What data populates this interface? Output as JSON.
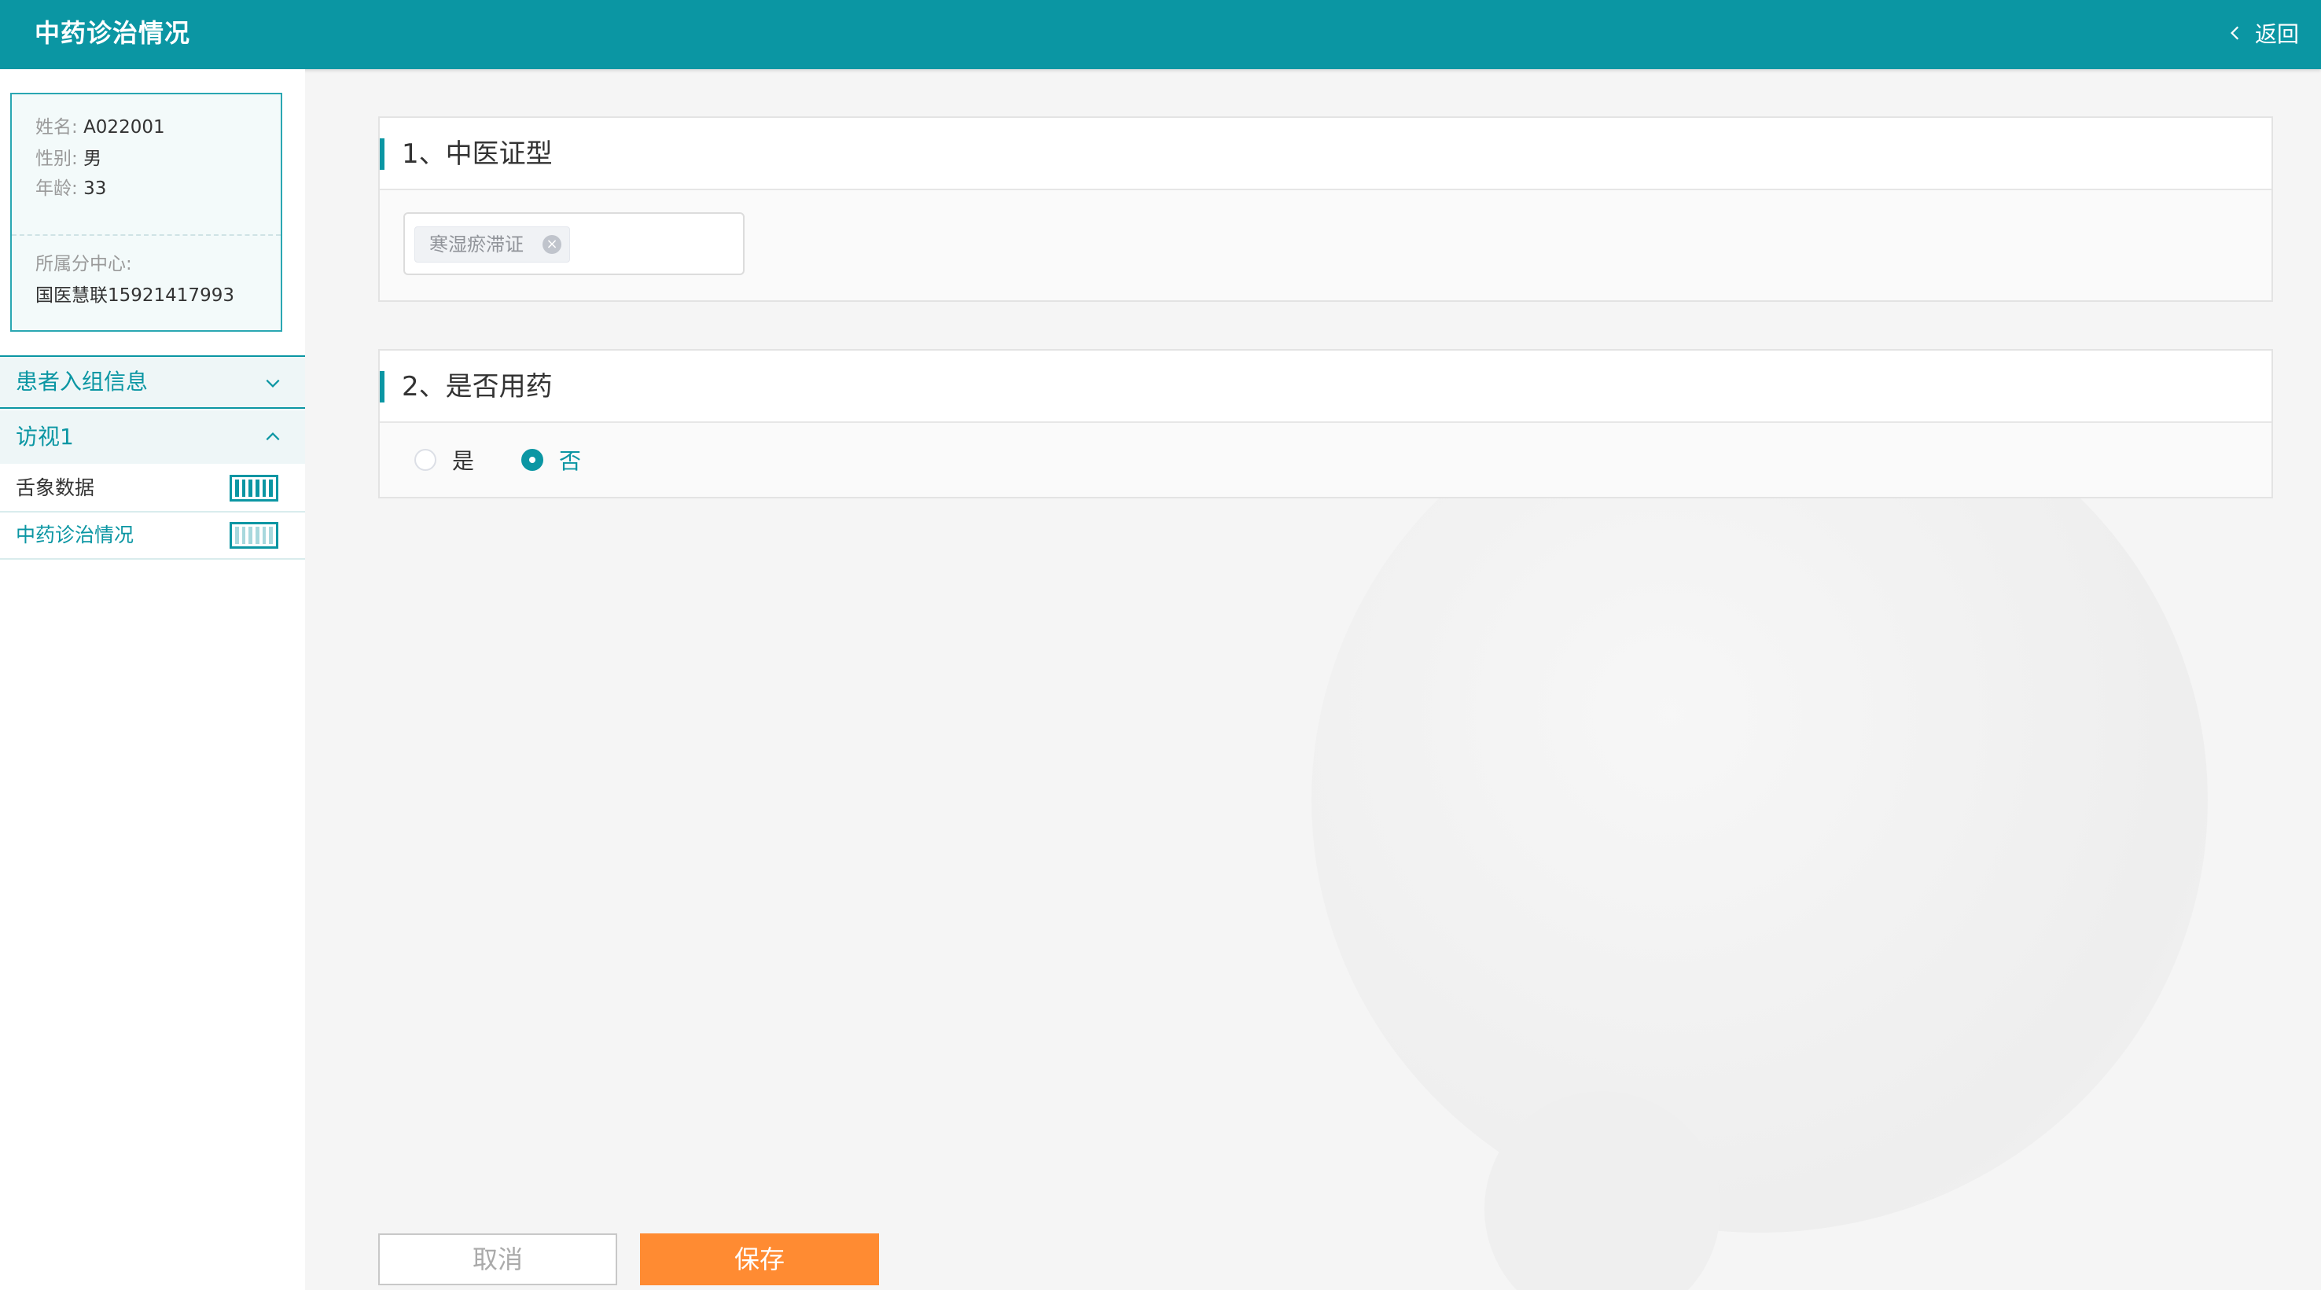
{
  "header": {
    "title": "中药诊治情况",
    "back_label": "返回"
  },
  "patient": {
    "name_label": "姓名:",
    "name": "A022001",
    "gender_label": "性别:",
    "gender": "男",
    "age_label": "年龄:",
    "age": "33",
    "center_label": "所属分中心:",
    "center": "国医慧联15921417993"
  },
  "nav": {
    "section_label": "患者入组信息",
    "visit_label": "访视1",
    "items": [
      {
        "label": "舌象数据",
        "progress": 1.0
      },
      {
        "label": "中药诊治情况",
        "progress": 0.0
      }
    ]
  },
  "questions": {
    "q1": {
      "title": "1、中医证型",
      "selected_tag": "寒湿瘀滞证"
    },
    "q2": {
      "title": "2、是否用药",
      "options": [
        "是",
        "否"
      ],
      "selected": "否"
    }
  },
  "actions": {
    "cancel_label": "取消",
    "save_label": "保存"
  },
  "colors": {
    "primary": "#0b96a3",
    "save_button": "#ff8b32"
  }
}
